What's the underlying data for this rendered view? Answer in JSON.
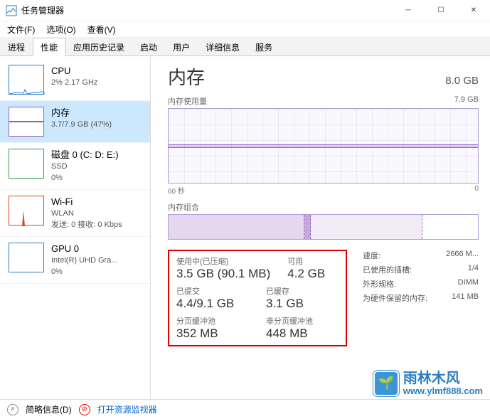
{
  "window": {
    "title": "任务管理器"
  },
  "menu": {
    "file": "文件(F)",
    "options": "选项(O)",
    "view": "查看(V)"
  },
  "tabs": [
    "进程",
    "性能",
    "应用历史记录",
    "启动",
    "用户",
    "详细信息",
    "服务"
  ],
  "activeTab": 1,
  "sidebar": [
    {
      "title": "CPU",
      "line2": "2% 2.17 GHz",
      "color": "#2a7fc3"
    },
    {
      "title": "内存",
      "line2": "3.7/7.9 GB (47%)",
      "color": "#9760bd"
    },
    {
      "title": "磁盘 0 (C: D: E:)",
      "line2": "SSD",
      "line3": "0%",
      "color": "#2f9e44"
    },
    {
      "title": "Wi-Fi",
      "line2": "WLAN",
      "line3": "发送: 0 接收: 0 Kbps",
      "color": "#d9480f"
    },
    {
      "title": "GPU 0",
      "line2": "Intel(R) UHD Gra...",
      "line3": "0%",
      "color": "#2a7fc3"
    }
  ],
  "main": {
    "title": "内存",
    "total": "8.0 GB",
    "usageLabel": "内存使用量",
    "usageMax": "7.9 GB",
    "xLeft": "60 秒",
    "xRight": "0",
    "compLabel": "内存组合"
  },
  "statsLeft": {
    "r1c1_lbl": "使用中(已压缩)",
    "r1c1_val": "3.5 GB (90.1 MB)",
    "r1c2_lbl": "可用",
    "r1c2_val": "4.2 GB",
    "r2c1_lbl": "已提交",
    "r2c1_val": "4.4/9.1 GB",
    "r2c2_lbl": "已缓存",
    "r2c2_val": "3.1 GB",
    "r3c1_lbl": "分页缓冲池",
    "r3c1_val": "352 MB",
    "r3c2_lbl": "非分页缓冲池",
    "r3c2_val": "448 MB"
  },
  "statsRight": [
    {
      "k": "速度:",
      "v": "2666 M..."
    },
    {
      "k": "已使用的插槽:",
      "v": "1/4"
    },
    {
      "k": "外形规格:",
      "v": "DIMM"
    },
    {
      "k": "为硬件保留的内存:",
      "v": "141 MB"
    }
  ],
  "status": {
    "brief": "简略信息(D)",
    "openResMon": "打开资源监视器"
  },
  "watermark": {
    "cn": "雨林木风",
    "url": "www.ylmf888.com"
  }
}
